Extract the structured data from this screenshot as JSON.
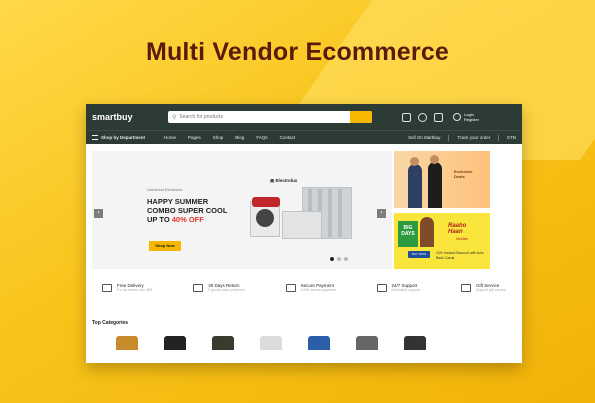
{
  "headline": "Multi Vendor Ecommerce",
  "store": {
    "logo": "smartbuy",
    "search": {
      "placeholder": "Search for products"
    },
    "account": {
      "line1": "Login",
      "line2": "Register"
    }
  },
  "nav": {
    "department": "Shop by Department",
    "links": [
      "Home",
      "Pages",
      "Shop",
      "Blog",
      "FAQs",
      "Contact"
    ],
    "sell": "Sell On Martbuy",
    "track": "Track your order",
    "currency": "ETB"
  },
  "hero": {
    "small": "Universal Electronic",
    "line1": "HAPPY SUMMER",
    "line2": "COMBO SUPER COOL",
    "line3_prefix": "UP TO ",
    "line3_highlight": "40% OFF",
    "cta": "Shop Now",
    "brand": "Electrolux"
  },
  "banner_right_1": {
    "text": "Exclusive Deals"
  },
  "banner_right_2": {
    "logo": "BIG DAYS",
    "brand_line1": "Raaho",
    "brand_line2": "Haan",
    "sub": "Mobiles",
    "pill": "BUY NOW",
    "offer": "10% Instant Discount with Axis Bank Cards"
  },
  "services": [
    {
      "title": "Free Delivery",
      "sub": "For all orders over $99"
    },
    {
      "title": "30 Days Return",
      "sub": "If goods have problems"
    },
    {
      "title": "Secure Payment",
      "sub": "100% secure payment"
    },
    {
      "title": "24/7 Support",
      "sub": "Dedicated support"
    },
    {
      "title": "Gift Service",
      "sub": "Support gift service"
    }
  ],
  "top_categories_title": "Top Categories",
  "colors": {
    "background": "#f6c017",
    "headline": "#5a1a0c",
    "topbar": "#2d3b35",
    "accent": "#f5b700",
    "offer": "#e0352b"
  }
}
